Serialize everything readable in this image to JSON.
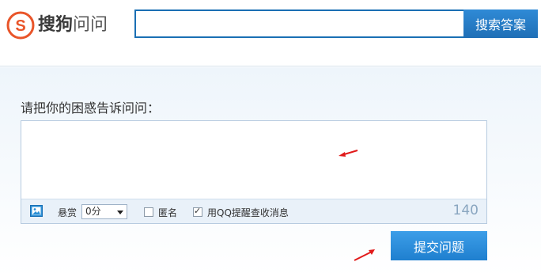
{
  "header": {
    "logo_brand": "搜狗",
    "logo_sub": "问问",
    "logo_icon": "sogou-s-logo-icon",
    "search_placeholder": "",
    "search_value": "",
    "search_button_label": "搜索答案"
  },
  "form": {
    "prompt_label": "请把你的困惑告诉问问：",
    "question_text": "",
    "toolbar": {
      "image_icon": "image-icon",
      "bounty_label": "悬赏",
      "bounty_value": "0分",
      "anonymous_label": "匿名",
      "anonymous_checked": false,
      "qq_notify_label": "用QQ提醒查收消息",
      "qq_notify_checked": true,
      "char_count": "140"
    },
    "submit_label": "提交问题"
  },
  "colors": {
    "accent": "#1f7fcf",
    "logo_orange": "#e9552a",
    "arrow_red": "#e11a1a"
  }
}
